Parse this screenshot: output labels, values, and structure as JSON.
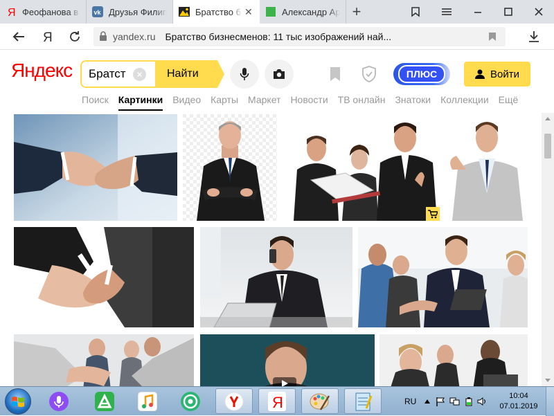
{
  "browser": {
    "tabs": [
      {
        "title": "Феофанова в",
        "icon": "yandex-y-icon",
        "active": false
      },
      {
        "title": "Друзья Филип",
        "icon": "vk-icon",
        "active": false
      },
      {
        "title": "Братство би",
        "icon": "yandex-images-icon",
        "active": true
      },
      {
        "title": "Александр Ар",
        "icon": "green-square-icon",
        "active": false
      }
    ],
    "address": {
      "domain": "yandex.ru",
      "page_title": "Братство бизнесменов: 11 тыс изображений най..."
    }
  },
  "yandex": {
    "logo": "Яндекс",
    "search": {
      "value": "Братст",
      "button": "Найти"
    },
    "plus_label": "ПЛЮС",
    "login_label": "Войти",
    "services": [
      "Поиск",
      "Картинки",
      "Видео",
      "Карты",
      "Маркет",
      "Новости",
      "ТВ онлайн",
      "Знатоки",
      "Коллекции",
      "Ещё"
    ],
    "active_service": "Картинки"
  },
  "images": [
    {
      "name": "handshake-blue-office"
    },
    {
      "name": "businessman-arms-crossed"
    },
    {
      "name": "business-team-thumbs-up",
      "badge": "shopping-cart-icon"
    },
    {
      "name": "smiling-businessman-grey-suit"
    },
    {
      "name": "handshake-closeup"
    },
    {
      "name": "businessman-phone-laptop"
    },
    {
      "name": "business-meeting-handshake"
    },
    {
      "name": "handshake-team-background"
    },
    {
      "name": "man-portrait-teal",
      "badge": "play-icon"
    },
    {
      "name": "business-meeting-table"
    }
  ],
  "taskbar": {
    "apps": [
      "alice-icon",
      "aptoide-icon",
      "music-icon",
      "at-mail-icon",
      "yandex-browser-icon",
      "yandex-icon",
      "paint-icon",
      "notepad-icon"
    ],
    "lang": "RU",
    "time": "10:04",
    "date": "07.01.2019"
  },
  "colors": {
    "yandex_yellow": "#ffdb4d",
    "yandex_red": "#ff0000",
    "plus_blue": "#3451f5"
  }
}
